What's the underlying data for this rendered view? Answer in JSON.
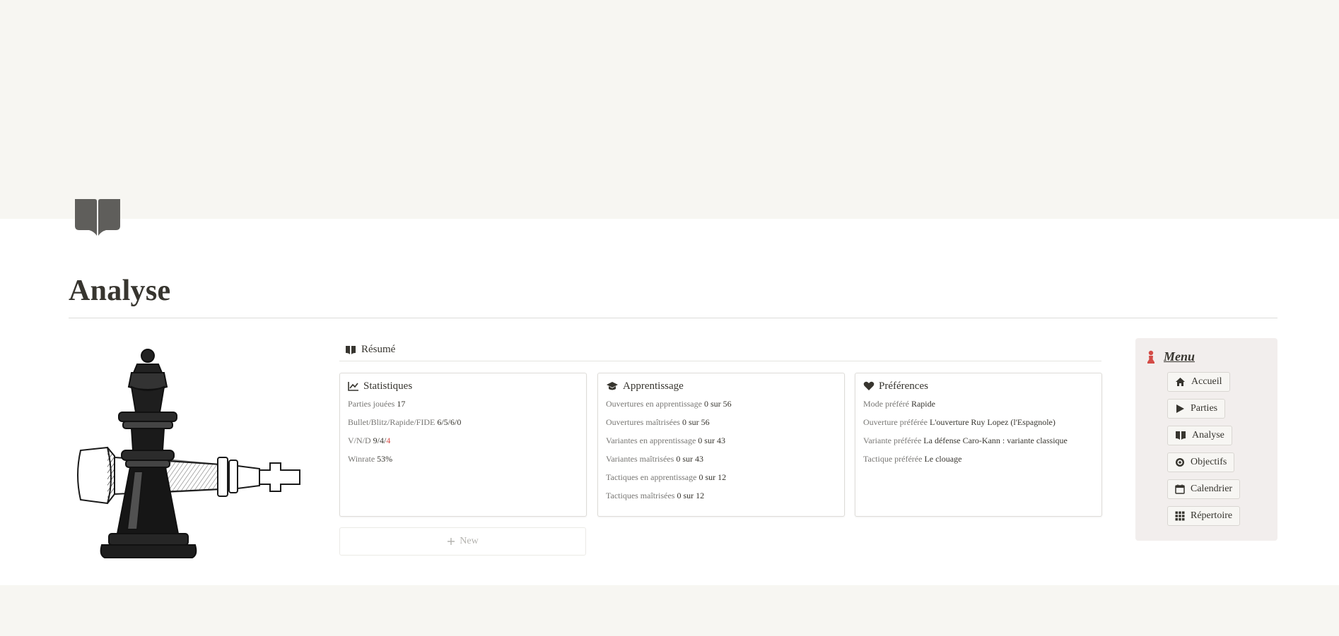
{
  "page": {
    "title": "Analyse",
    "icon": "book-open-icon"
  },
  "summary": {
    "label": "Résumé",
    "icon": "book-open-icon"
  },
  "cards": {
    "stats": {
      "title": "Statistiques",
      "icon": "chart-line-icon",
      "rows": [
        {
          "key": "Parties jouées",
          "value": "17"
        },
        {
          "key": "Bullet/Blitz/Rapide/FIDE",
          "value": "6/5/6/0"
        },
        {
          "key": "V/N/D",
          "value_a": "9/4/",
          "value_b": "4"
        },
        {
          "key": "Winrate",
          "value": "53%"
        }
      ]
    },
    "learning": {
      "title": "Apprentissage",
      "icon": "graduation-cap-icon",
      "rows": [
        {
          "key": "Ouvertures en apprentissage",
          "value": "0 sur 56"
        },
        {
          "key": "Ouvertures maîtrisées",
          "value": "0 sur 56"
        },
        {
          "key": "Variantes en apprentissage",
          "value": "0 sur 43"
        },
        {
          "key": "Variantes maîtrisées",
          "value": "0 sur 43"
        },
        {
          "key": "Tactiques en apprentissage",
          "value": "0 sur 12"
        },
        {
          "key": "Tactiques maîtrisées",
          "value": "0 sur 12"
        }
      ]
    },
    "prefs": {
      "title": "Préférences",
      "icon": "heart-icon",
      "rows": [
        {
          "key": "Mode préféré",
          "value": "Rapide"
        },
        {
          "key": "Ouverture préférée",
          "value": "L'ouverture Ruy Lopez (l'Espagnole)"
        },
        {
          "key": "Variante préférée",
          "value": "La défense Caro-Kann : variante classique"
        },
        {
          "key": "Tactique préférée",
          "value": "Le clouage"
        }
      ]
    }
  },
  "new_button": {
    "label": "New"
  },
  "menu": {
    "title": "Menu",
    "icon": "pawn-icon",
    "items": [
      {
        "label": "Accueil",
        "icon": "home-icon"
      },
      {
        "label": "Parties",
        "icon": "play-icon"
      },
      {
        "label": "Analyse",
        "icon": "book-open-icon"
      },
      {
        "label": "Objectifs",
        "icon": "target-icon"
      },
      {
        "label": "Calendrier",
        "icon": "calendar-icon"
      },
      {
        "label": "Répertoire",
        "icon": "grid-icon"
      }
    ]
  },
  "colors": {
    "accent_red": "#d44c47",
    "cover": "#f7f6f2",
    "menu_bg": "#f2eeed"
  }
}
